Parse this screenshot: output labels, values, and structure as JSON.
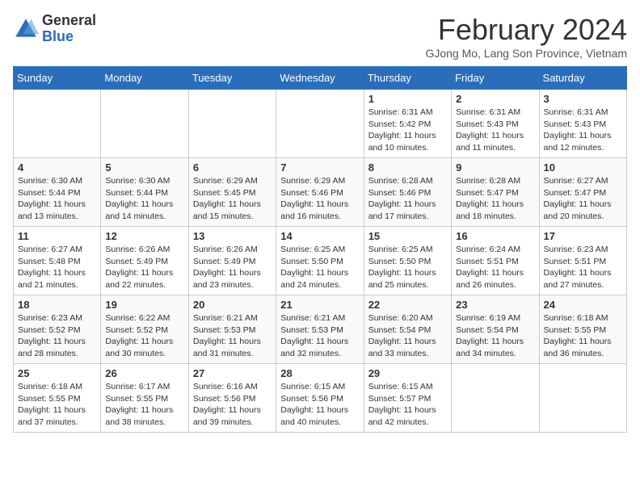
{
  "header": {
    "logo_general": "General",
    "logo_blue": "Blue",
    "title": "February 2024",
    "location": "GJong Mo, Lang Son Province, Vietnam"
  },
  "days_of_week": [
    "Sunday",
    "Monday",
    "Tuesday",
    "Wednesday",
    "Thursday",
    "Friday",
    "Saturday"
  ],
  "weeks": [
    [
      {
        "day": "",
        "info": ""
      },
      {
        "day": "",
        "info": ""
      },
      {
        "day": "",
        "info": ""
      },
      {
        "day": "",
        "info": ""
      },
      {
        "day": "1",
        "info": "Sunrise: 6:31 AM\nSunset: 5:42 PM\nDaylight: 11 hours\nand 10 minutes."
      },
      {
        "day": "2",
        "info": "Sunrise: 6:31 AM\nSunset: 5:43 PM\nDaylight: 11 hours\nand 11 minutes."
      },
      {
        "day": "3",
        "info": "Sunrise: 6:31 AM\nSunset: 5:43 PM\nDaylight: 11 hours\nand 12 minutes."
      }
    ],
    [
      {
        "day": "4",
        "info": "Sunrise: 6:30 AM\nSunset: 5:44 PM\nDaylight: 11 hours\nand 13 minutes."
      },
      {
        "day": "5",
        "info": "Sunrise: 6:30 AM\nSunset: 5:44 PM\nDaylight: 11 hours\nand 14 minutes."
      },
      {
        "day": "6",
        "info": "Sunrise: 6:29 AM\nSunset: 5:45 PM\nDaylight: 11 hours\nand 15 minutes."
      },
      {
        "day": "7",
        "info": "Sunrise: 6:29 AM\nSunset: 5:46 PM\nDaylight: 11 hours\nand 16 minutes."
      },
      {
        "day": "8",
        "info": "Sunrise: 6:28 AM\nSunset: 5:46 PM\nDaylight: 11 hours\nand 17 minutes."
      },
      {
        "day": "9",
        "info": "Sunrise: 6:28 AM\nSunset: 5:47 PM\nDaylight: 11 hours\nand 18 minutes."
      },
      {
        "day": "10",
        "info": "Sunrise: 6:27 AM\nSunset: 5:47 PM\nDaylight: 11 hours\nand 20 minutes."
      }
    ],
    [
      {
        "day": "11",
        "info": "Sunrise: 6:27 AM\nSunset: 5:48 PM\nDaylight: 11 hours\nand 21 minutes."
      },
      {
        "day": "12",
        "info": "Sunrise: 6:26 AM\nSunset: 5:49 PM\nDaylight: 11 hours\nand 22 minutes."
      },
      {
        "day": "13",
        "info": "Sunrise: 6:26 AM\nSunset: 5:49 PM\nDaylight: 11 hours\nand 23 minutes."
      },
      {
        "day": "14",
        "info": "Sunrise: 6:25 AM\nSunset: 5:50 PM\nDaylight: 11 hours\nand 24 minutes."
      },
      {
        "day": "15",
        "info": "Sunrise: 6:25 AM\nSunset: 5:50 PM\nDaylight: 11 hours\nand 25 minutes."
      },
      {
        "day": "16",
        "info": "Sunrise: 6:24 AM\nSunset: 5:51 PM\nDaylight: 11 hours\nand 26 minutes."
      },
      {
        "day": "17",
        "info": "Sunrise: 6:23 AM\nSunset: 5:51 PM\nDaylight: 11 hours\nand 27 minutes."
      }
    ],
    [
      {
        "day": "18",
        "info": "Sunrise: 6:23 AM\nSunset: 5:52 PM\nDaylight: 11 hours\nand 28 minutes."
      },
      {
        "day": "19",
        "info": "Sunrise: 6:22 AM\nSunset: 5:52 PM\nDaylight: 11 hours\nand 30 minutes."
      },
      {
        "day": "20",
        "info": "Sunrise: 6:21 AM\nSunset: 5:53 PM\nDaylight: 11 hours\nand 31 minutes."
      },
      {
        "day": "21",
        "info": "Sunrise: 6:21 AM\nSunset: 5:53 PM\nDaylight: 11 hours\nand 32 minutes."
      },
      {
        "day": "22",
        "info": "Sunrise: 6:20 AM\nSunset: 5:54 PM\nDaylight: 11 hours\nand 33 minutes."
      },
      {
        "day": "23",
        "info": "Sunrise: 6:19 AM\nSunset: 5:54 PM\nDaylight: 11 hours\nand 34 minutes."
      },
      {
        "day": "24",
        "info": "Sunrise: 6:18 AM\nSunset: 5:55 PM\nDaylight: 11 hours\nand 36 minutes."
      }
    ],
    [
      {
        "day": "25",
        "info": "Sunrise: 6:18 AM\nSunset: 5:55 PM\nDaylight: 11 hours\nand 37 minutes."
      },
      {
        "day": "26",
        "info": "Sunrise: 6:17 AM\nSunset: 5:55 PM\nDaylight: 11 hours\nand 38 minutes."
      },
      {
        "day": "27",
        "info": "Sunrise: 6:16 AM\nSunset: 5:56 PM\nDaylight: 11 hours\nand 39 minutes."
      },
      {
        "day": "28",
        "info": "Sunrise: 6:15 AM\nSunset: 5:56 PM\nDaylight: 11 hours\nand 40 minutes."
      },
      {
        "day": "29",
        "info": "Sunrise: 6:15 AM\nSunset: 5:57 PM\nDaylight: 11 hours\nand 42 minutes."
      },
      {
        "day": "",
        "info": ""
      },
      {
        "day": "",
        "info": ""
      }
    ]
  ]
}
